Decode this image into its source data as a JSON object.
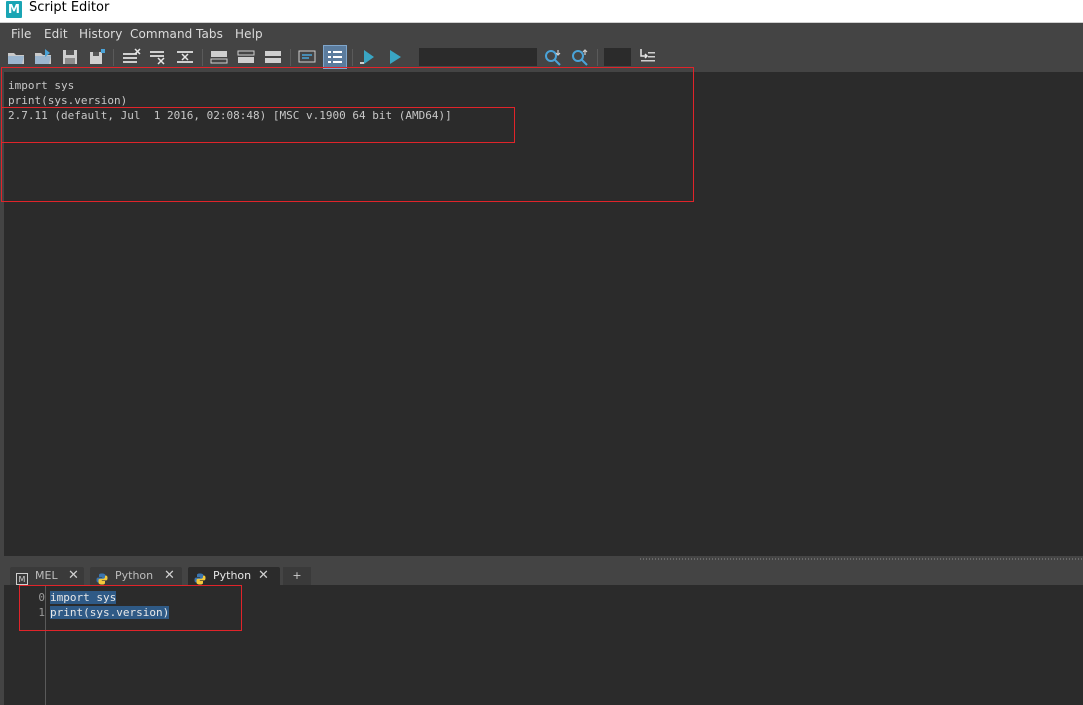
{
  "window": {
    "title": "Script Editor",
    "logo_letter": "M"
  },
  "menu": [
    "File",
    "Edit",
    "History",
    "Command",
    "Tabs",
    "Help"
  ],
  "toolbar": {
    "search_value": "",
    "buttons": [
      "open-script-icon",
      "source-script-icon",
      "save-script-icon",
      "save-script-to-shelf-icon",
      "clear-history-icon",
      "clear-input-icon",
      "clear-all-icon",
      "show-history-icon",
      "show-input-icon",
      "show-both-icon",
      "echo-all-commands-icon",
      "show-line-numbers-icon",
      "execute-selected-icon",
      "execute-all-icon",
      "search-down-icon",
      "search-up-icon",
      "go-to-line-icon"
    ]
  },
  "output": {
    "lines": [
      "import sys",
      "print(sys.version)",
      "2.7.11 (default, Jul  1 2016, 02:08:48) [MSC v.1900 64 bit (AMD64)]"
    ]
  },
  "tabs": [
    {
      "label": "MEL",
      "icon": "mel-icon",
      "active": false,
      "close": "✕"
    },
    {
      "label": "Python",
      "icon": "python-icon",
      "active": false,
      "close": "✕"
    },
    {
      "label": "Python",
      "icon": "python-icon",
      "active": true,
      "close": "✕"
    }
  ],
  "tab_add_label": "+",
  "editor": {
    "lines": [
      {
        "num": "0",
        "code": "import sys"
      },
      {
        "num": "1",
        "code": "print(sys.version)"
      }
    ]
  },
  "colors": {
    "background": "#444444",
    "pane": "#2b2b2b",
    "selection": "#2f5a86",
    "annotation": "#e0242a",
    "accent": "#1aa5b4"
  }
}
